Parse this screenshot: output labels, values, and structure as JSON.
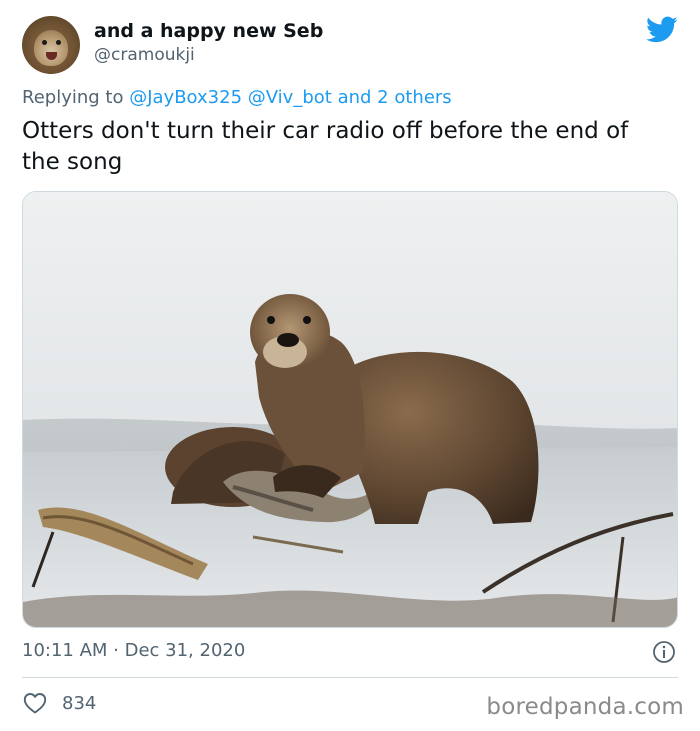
{
  "author": {
    "display_name": "and a happy new Seb",
    "handle": "@cramoukji"
  },
  "reply": {
    "prefix": "Replying to",
    "mention_1": "@JayBox325",
    "mention_2": "@Viv_bot",
    "suffix": "and 2 others"
  },
  "tweet": {
    "text": "Otters don't turn their car radio off before the end of the song",
    "timestamp": "10:11 AM · Dec 31, 2020",
    "likes": "834"
  },
  "watermark": "boredpanda.com",
  "icons": {
    "brand": "twitter-bird-icon",
    "info": "info-icon",
    "like": "heart-icon"
  },
  "colors": {
    "twitter_blue": "#1d9bf0",
    "secondary_text": "#536471",
    "primary_text": "#0f1419"
  }
}
